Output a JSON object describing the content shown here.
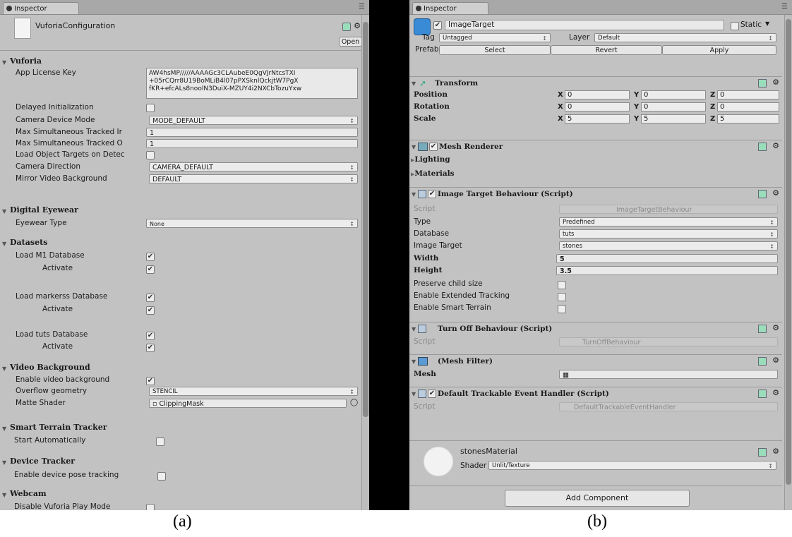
{
  "left": {
    "tab": "Inspector",
    "asset_name": "VuforiaConfiguration",
    "open_button": "Open",
    "sections": {
      "vuforia": "Vuforia",
      "digital_eyewear": "Digital Eyewear",
      "datasets": "Datasets",
      "video_background": "Video Background",
      "smart_terrain": "Smart Terrain Tracker",
      "device_tracker": "Device Tracker",
      "webcam": "Webcam"
    },
    "labels": {
      "app_license_key": "App License Key",
      "delayed_init": "Delayed Initialization",
      "camera_device_mode": "Camera Device Mode",
      "max_tracked_images": "Max Simultaneous Tracked Ir",
      "max_tracked_objects": "Max Simultaneous Tracked O",
      "load_object_targets": "Load Object Targets on Detec",
      "camera_direction": "Camera Direction",
      "mirror_video_bg": "Mirror Video Background",
      "eyewear_type": "Eyewear Type",
      "load_m1_db": "Load M1 Database",
      "activate": "Activate",
      "load_markerss_db": "Load markerss Database",
      "load_tuts_db": "Load tuts Database",
      "enable_video_bg": "Enable video background",
      "overflow_geometry": "Overflow geometry",
      "matte_shader": "Matte Shader",
      "start_automatically": "Start Automatically",
      "enable_device_pose": "Enable device pose tracking",
      "disable_play_mode": "Disable Vuforia Play Mode"
    },
    "values": {
      "license_line1": "AW4hsMP/////AAAAGc3CLAubeE0QgVJrNtcsTXI",
      "license_line2": "+05rCQrr8U19BoMLiB4l07pPXSknlQckjtW7PgX",
      "license_line3": "fKR+efcALs8noolN3DuiX-MZUY4i2NXCbTozuYxw",
      "camera_device_mode": "MODE_DEFAULT",
      "max_tracked_images": "1",
      "max_tracked_objects": "1",
      "camera_direction": "CAMERA_DEFAULT",
      "mirror_video_bg": "DEFAULT",
      "eyewear_type": "None",
      "overflow_geometry": "STENCIL",
      "matte_shader": "ClippingMask"
    }
  },
  "right": {
    "tab": "Inspector",
    "object_name": "ImageTarget",
    "static_label": "Static",
    "tag_label": "Tag",
    "tag_value": "Untagged",
    "layer_label": "Layer",
    "layer_value": "Default",
    "prefab_label": "Prefab",
    "prefab_select": "Select",
    "prefab_revert": "Revert",
    "prefab_apply": "Apply",
    "transform": {
      "title": "Transform",
      "position": "Position",
      "rotation": "Rotation",
      "scale": "Scale",
      "x": "X",
      "y": "Y",
      "z": "Z",
      "pos": [
        "0",
        "0",
        "0"
      ],
      "rot": [
        "0",
        "0",
        "0"
      ],
      "scl": [
        "5",
        "5",
        "5"
      ]
    },
    "mesh_renderer": {
      "title": "Mesh Renderer",
      "lighting": "Lighting",
      "materials": "Materials"
    },
    "itb": {
      "title": "Image Target Behaviour (Script)",
      "script_label": "Script",
      "script_value": "ImageTargetBehaviour",
      "type_label": "Type",
      "type_value": "Predefined",
      "database_label": "Database",
      "database_value": "tuts",
      "image_target_label": "Image Target",
      "image_target_value": "stones",
      "width_label": "Width",
      "width_value": "5",
      "height_label": "Height",
      "height_value": "3.5",
      "preserve_child": "Preserve child size",
      "extended_tracking": "Enable Extended Tracking",
      "smart_terrain": "Enable Smart Terrain"
    },
    "turnoff": {
      "title": "Turn Off Behaviour (Script)",
      "script_label": "Script",
      "script_value": "TurnOffBehaviour"
    },
    "meshfilter": {
      "title": "(Mesh Filter)",
      "mesh_label": "Mesh"
    },
    "dteh": {
      "title": "Default Trackable Event Handler (Script)",
      "script_label": "Script",
      "script_value": "DefaultTrackableEventHandler"
    },
    "material": {
      "name": "stonesMaterial",
      "shader_label": "Shader",
      "shader_value": "Unlit/Texture"
    },
    "add_component": "Add Component"
  },
  "captions": {
    "a": "(a)",
    "b": "(b)"
  }
}
